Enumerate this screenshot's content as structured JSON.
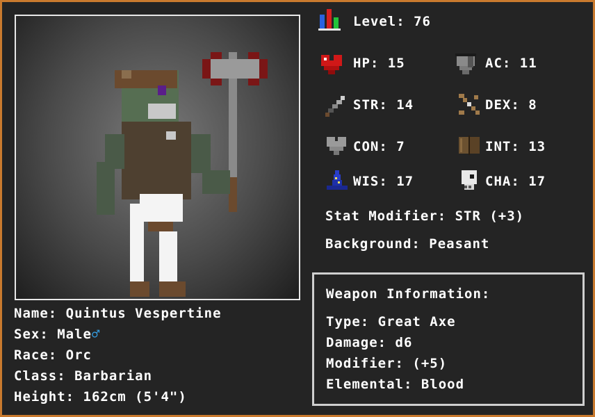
{
  "character": {
    "name_label": "Name: Quintus Vespertine",
    "sex_label": "Sex: Male",
    "sex_symbol": "♂",
    "race_label": "Race: Orc",
    "class_label": "Class: Barbarian",
    "height_label": "Height: 162cm (5'4\")"
  },
  "stats": {
    "level": "Level: 76",
    "hp": "HP: 15",
    "ac": "AC: 11",
    "str": "STR: 14",
    "dex": "DEX: 8",
    "con": "CON: 7",
    "int": "INT: 13",
    "wis": "WIS: 17",
    "cha": "CHA: 17",
    "stat_modifier": "Stat Modifier: STR (+3)",
    "background": "Background: Peasant"
  },
  "weapon": {
    "title": "Weapon Information:",
    "type": "Type: Great Axe",
    "damage": "Damage: d6",
    "modifier": "Modifier: (+5)",
    "elemental": "Elemental: Blood"
  },
  "icons": [
    "level-bars-icon",
    "heart-icon",
    "shield-icon",
    "sword-icon",
    "bow-icon",
    "gray-heart-icon",
    "book-icon",
    "wizard-hat-icon",
    "skull-mask-icon"
  ],
  "colors": {
    "frame": "#c97a2e",
    "background": "#242424",
    "text": "#ffffff",
    "male_symbol": "#35a0e6",
    "box_border": "#cfcfcf"
  }
}
